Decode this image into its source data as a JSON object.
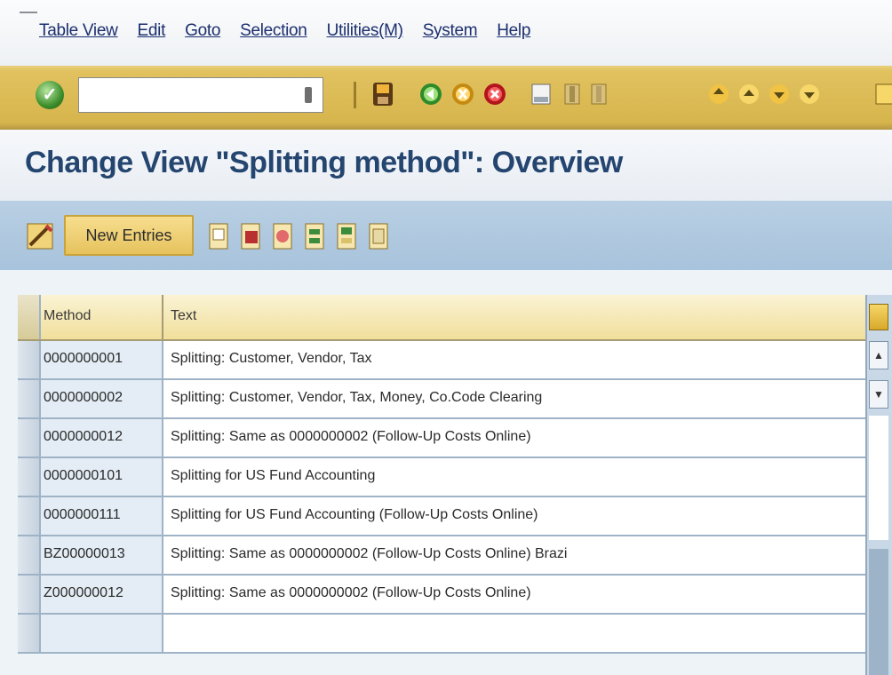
{
  "menu": [
    "Table View",
    "Edit",
    "Goto",
    "Selection",
    "Utilities(M)",
    "System",
    "Help"
  ],
  "command_field": {
    "value": ""
  },
  "page_title": "Change View \"Splitting method\": Overview",
  "app_toolbar": {
    "new_entries_label": "New Entries"
  },
  "table": {
    "columns": [
      "Method",
      "Text"
    ],
    "rows": [
      {
        "method": "0000000001",
        "text": "Splitting: Customer, Vendor, Tax"
      },
      {
        "method": "0000000002",
        "text": "Splitting: Customer, Vendor, Tax, Money, Co.Code Clearing"
      },
      {
        "method": "0000000012",
        "text": "Splitting: Same as 0000000002 (Follow-Up Costs Online)"
      },
      {
        "method": "0000000101",
        "text": " Splitting for US Fund Accounting"
      },
      {
        "method": "0000000111",
        "text": "Splitting for US Fund Accounting (Follow-Up Costs Online)"
      },
      {
        "method": "BZ00000013",
        "text": "Splitting: Same as 0000000002 (Follow-Up Costs Online) Brazi"
      },
      {
        "method": "Z000000012",
        "text": "Splitting: Same as 0000000002 (Follow-Up Costs Online)"
      }
    ]
  },
  "colors": {
    "menu_text": "#1c2f6e",
    "toolbar_gold": "#d7b54d",
    "title_text": "#24456f",
    "app_toolbar_blue": "#a8c3dc",
    "table_header": "#f1df9b"
  }
}
